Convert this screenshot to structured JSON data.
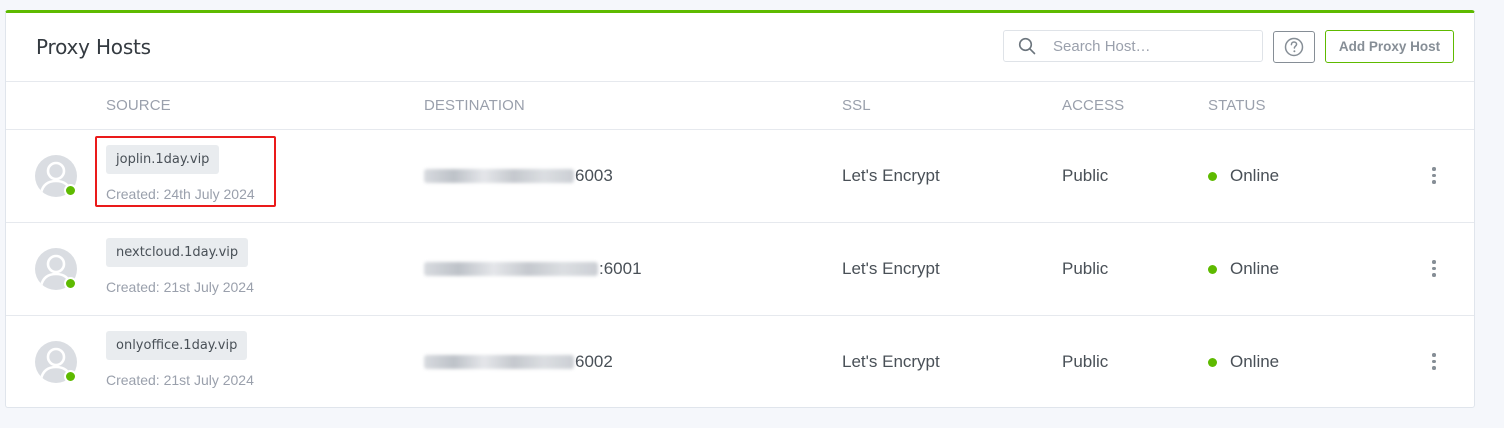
{
  "header": {
    "title": "Proxy Hosts",
    "search_placeholder": "Search Host…",
    "help_icon": "question-circle-icon",
    "add_button": "Add Proxy Host"
  },
  "columns": [
    "SOURCE",
    "DESTINATION",
    "SSL",
    "ACCESS",
    "STATUS"
  ],
  "rows": [
    {
      "host": "joplin.1day.vip",
      "created": "Created: 24th July 2024",
      "dest_suffix": "6003",
      "ssl": "Let's Encrypt",
      "access": "Public",
      "status": "Online"
    },
    {
      "host": "nextcloud.1day.vip",
      "created": "Created: 21st July 2024",
      "dest_suffix": ":6001",
      "ssl": "Let's Encrypt",
      "access": "Public",
      "status": "Online"
    },
    {
      "host": "onlyoffice.1day.vip",
      "created": "Created: 21st July 2024",
      "dest_suffix": "6002",
      "ssl": "Let's Encrypt",
      "access": "Public",
      "status": "Online"
    }
  ],
  "colors": {
    "accent": "#5eba00",
    "highlight": "#ea1a1a",
    "muted": "#9aa0ac"
  }
}
